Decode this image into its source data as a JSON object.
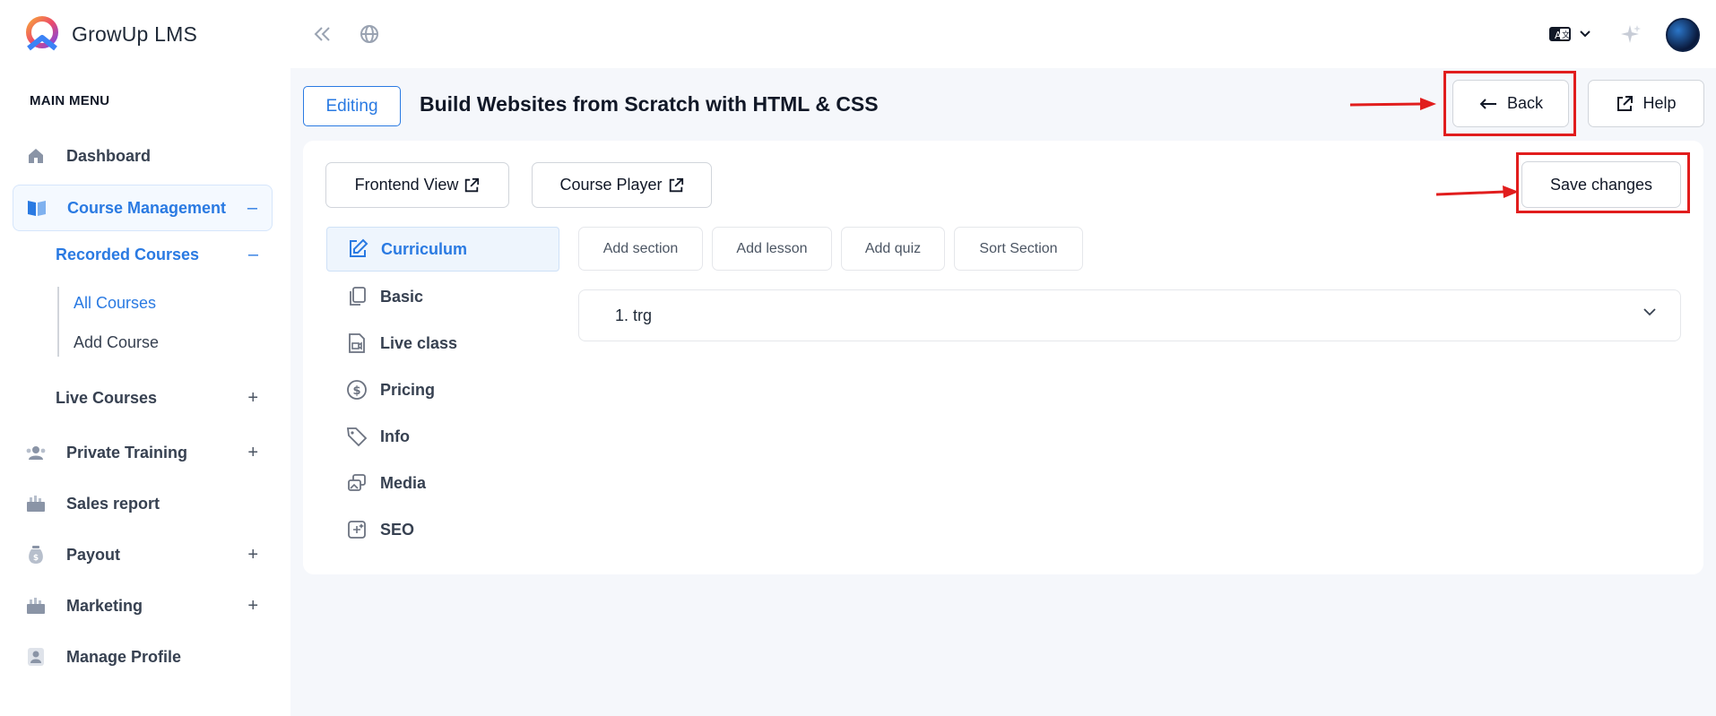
{
  "app": {
    "name": "GrowUp LMS"
  },
  "sidebar": {
    "menu_title": "MAIN MENU",
    "items": [
      {
        "label": "Dashboard",
        "icon": "home-icon"
      },
      {
        "label": "Course Management",
        "icon": "book-icon",
        "sign": "–"
      },
      {
        "label": "Private Training",
        "icon": "users-icon",
        "sign": "+"
      },
      {
        "label": "Sales report",
        "icon": "report-icon"
      },
      {
        "label": "Payout",
        "icon": "money-bag-icon",
        "sign": "+"
      },
      {
        "label": "Marketing",
        "icon": "marketing-icon",
        "sign": "+"
      },
      {
        "label": "Manage Profile",
        "icon": "profile-icon"
      }
    ],
    "recorded": {
      "label": "Recorded Courses",
      "sign": "–"
    },
    "leaves": [
      "All Courses",
      "Add Course"
    ],
    "live": {
      "label": "Live Courses",
      "sign": "+"
    }
  },
  "header": {
    "editing_label": "Editing",
    "course_title": "Build Websites from Scratch with HTML & CSS",
    "back_label": "Back",
    "help_label": "Help"
  },
  "toolbar": {
    "frontend_view": "Frontend View",
    "course_player": "Course Player",
    "save_changes": "Save changes"
  },
  "course_menu": [
    "Curriculum",
    "Basic",
    "Live class",
    "Pricing",
    "Info",
    "Media",
    "SEO"
  ],
  "curriculum_actions": [
    "Add section",
    "Add lesson",
    "Add quiz",
    "Sort Section"
  ],
  "sections": [
    {
      "label": "1. trg"
    }
  ],
  "colors": {
    "accent": "#2a7ae2",
    "highlight": "#e11d1d"
  }
}
